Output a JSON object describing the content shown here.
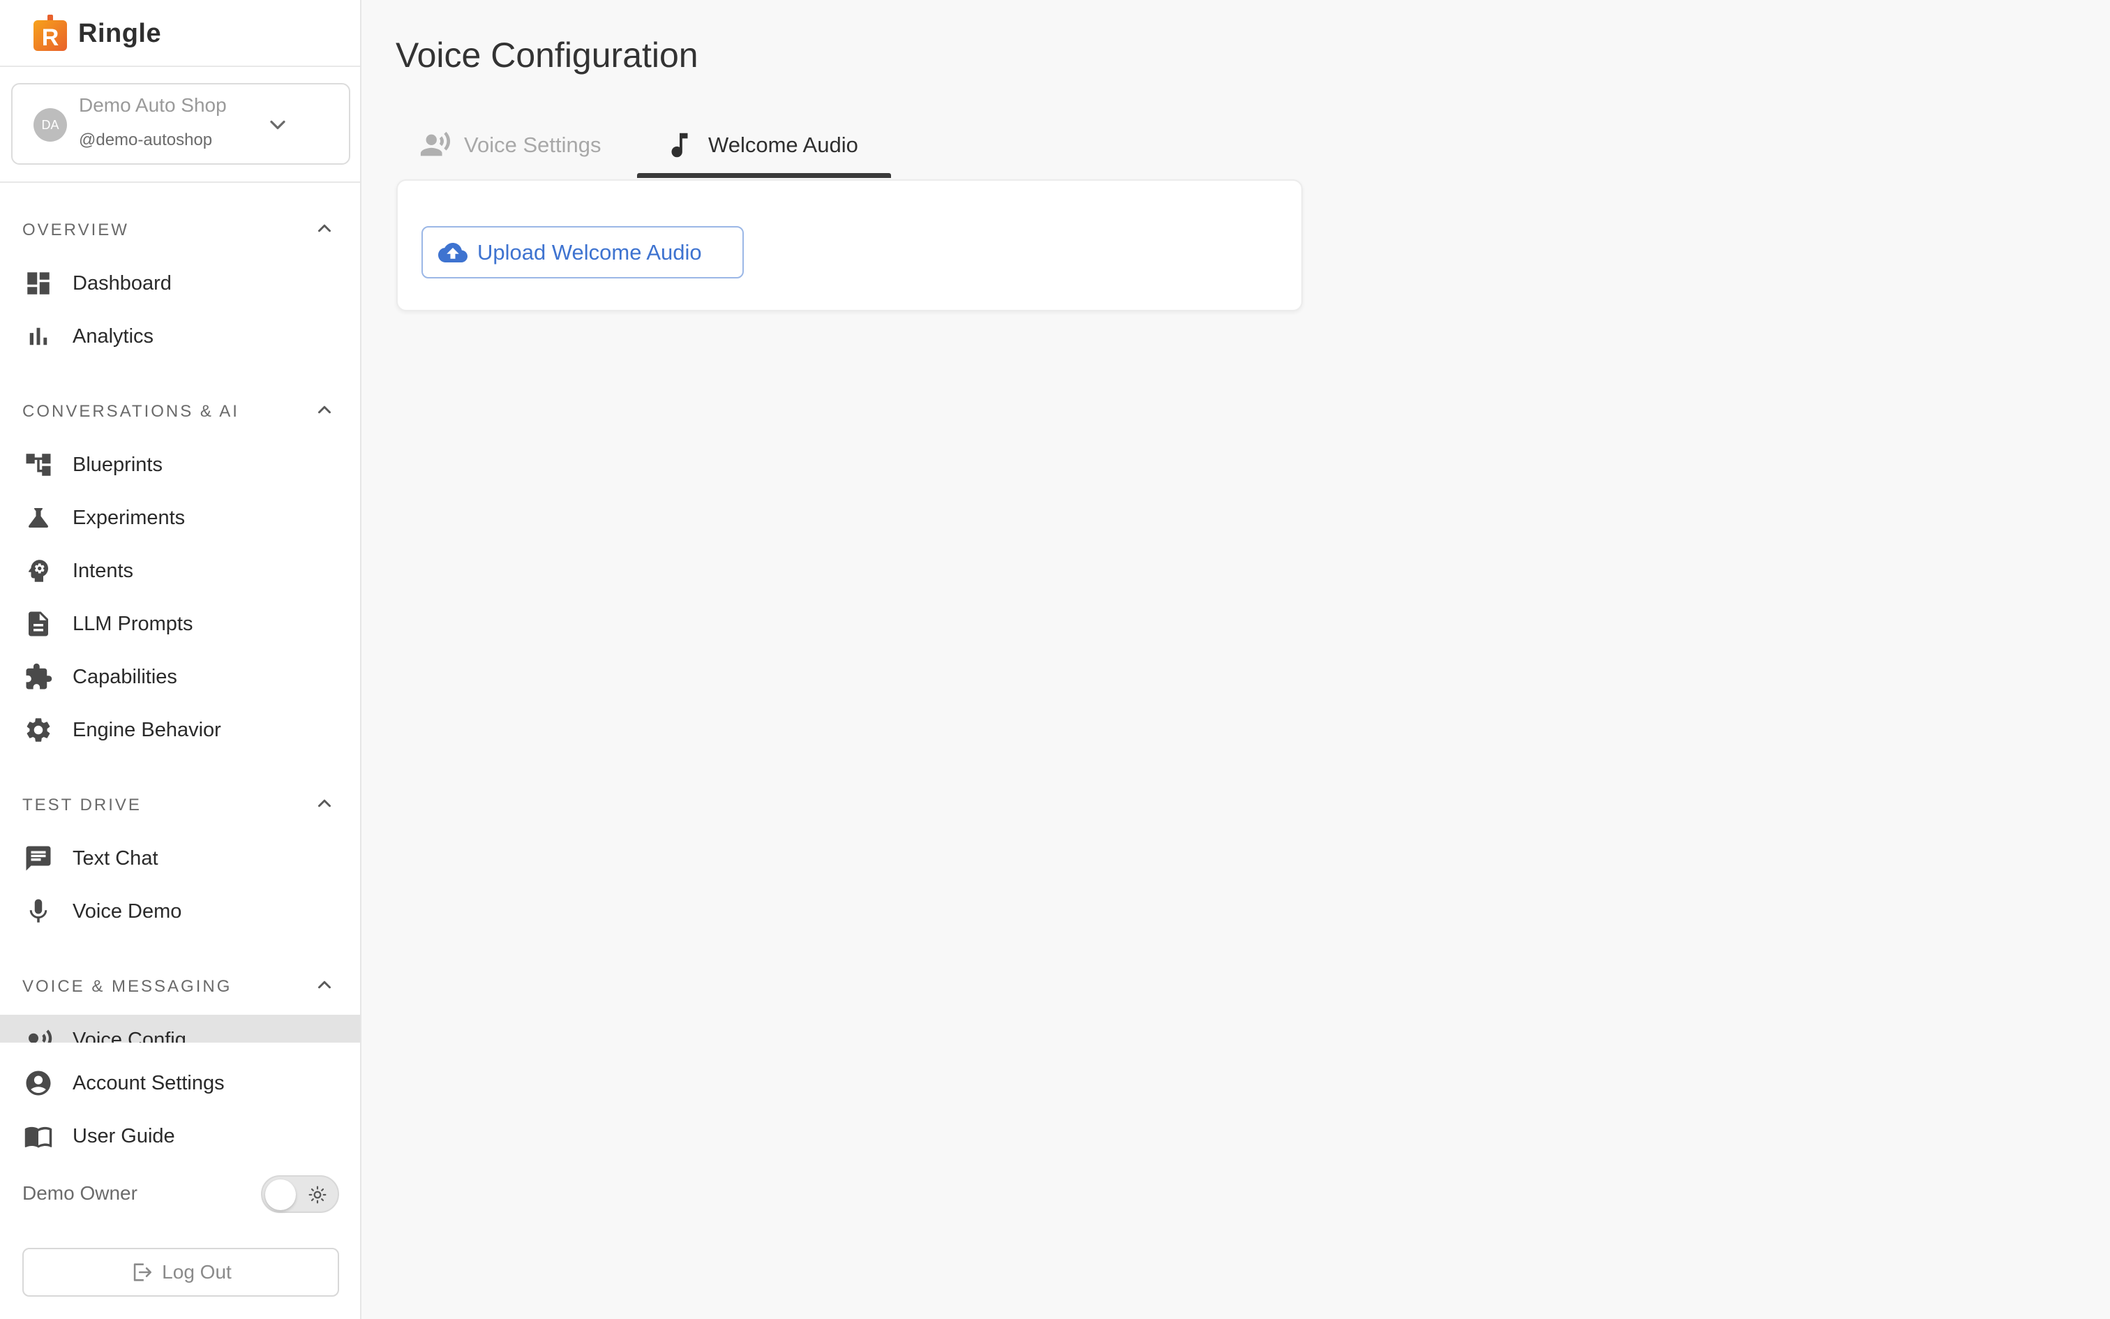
{
  "brand": {
    "name": "Ringle",
    "logo_letter": "R"
  },
  "account": {
    "initials": "DA",
    "name": "Demo Auto Shop",
    "handle": "@demo-autoshop"
  },
  "sections": {
    "overview": "OVERVIEW",
    "conversations": "CONVERSATIONS & AI",
    "test_drive": "TEST DRIVE",
    "voice_messaging": "VOICE & MESSAGING"
  },
  "nav": {
    "dashboard": "Dashboard",
    "analytics": "Analytics",
    "blueprints": "Blueprints",
    "experiments": "Experiments",
    "intents": "Intents",
    "llm_prompts": "LLM Prompts",
    "capabilities": "Capabilities",
    "engine_behavior": "Engine Behavior",
    "text_chat": "Text Chat",
    "voice_demo": "Voice Demo",
    "voice_config": "Voice Config",
    "account_settings": "Account Settings",
    "user_guide": "User Guide"
  },
  "footer": {
    "owner": "Demo Owner",
    "logout": "Log Out",
    "theme_toggle": "off"
  },
  "main": {
    "title": "Voice Configuration",
    "tabs": [
      {
        "label": "Voice Settings",
        "icon": "voice-settings-icon",
        "active": false
      },
      {
        "label": "Welcome Audio",
        "icon": "music-note-icon",
        "active": true
      }
    ],
    "upload_button": "Upload Welcome Audio"
  },
  "colors": {
    "accent_blue": "#3e73d0",
    "brand_orange": "#f08a24",
    "active_nav_bg": "#e3e3e3",
    "tab_indicator": "#3a3a3a"
  }
}
